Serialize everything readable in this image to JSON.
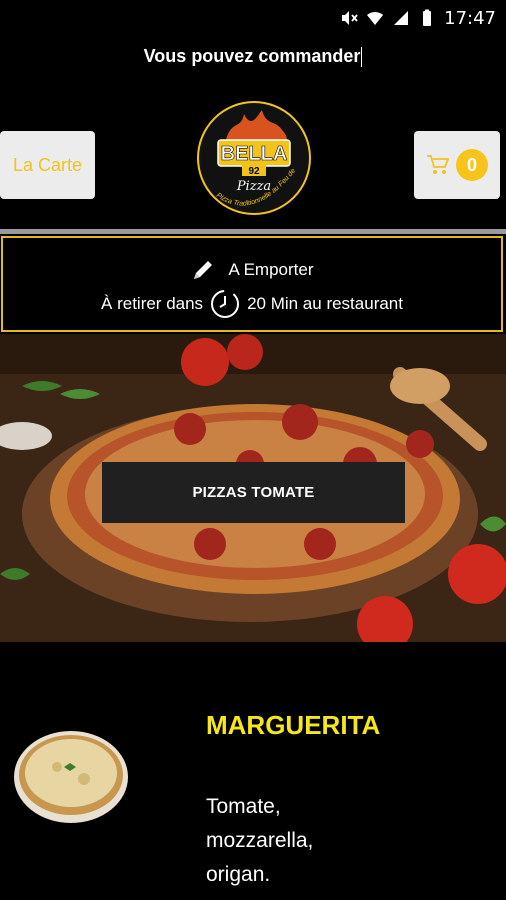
{
  "status_bar": {
    "time": "17:47"
  },
  "header": {
    "title": "Vous pouvez commander"
  },
  "toolbar": {
    "carte_label": "La Carte",
    "cart_count": "0"
  },
  "logo": {
    "brand_text": "BELLA",
    "number_text": "92",
    "sub_text": "Pizza",
    "tagline": "Pizza Traditionnelle au Feu de Bois"
  },
  "order": {
    "mode_label": "A Emporter",
    "pickup_prefix": "À retirer dans",
    "pickup_suffix": "20 Min au restaurant"
  },
  "category": {
    "label": "PIZZAS TOMATE"
  },
  "product": {
    "name": "MARGUERITA",
    "description": "Tomate, mozzarella, origan."
  },
  "colors": {
    "accent_yellow": "#f7c41c",
    "product_title": "#f5e71b",
    "border_gold": "#e6bb17"
  }
}
